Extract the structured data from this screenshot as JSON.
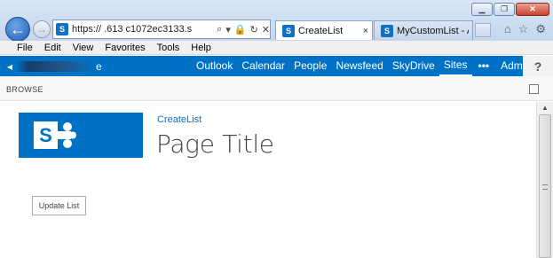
{
  "window": {
    "minimize_glyph": "▁",
    "restore_glyph": "❐",
    "close_glyph": "✕"
  },
  "browser": {
    "back_glyph": "←",
    "forward_glyph": "→",
    "address_url": "https://           .613    c1072ec3133.s",
    "address_tools": [
      "⌕",
      "▾",
      "🔒",
      "↻",
      "✕"
    ],
    "tabs": [
      {
        "label": "CreateList",
        "close": "×"
      },
      {
        "label": "MyCustomList - All...",
        "close": ""
      }
    ],
    "tool_icons": [
      "⌂",
      "☆",
      "⚙"
    ]
  },
  "menubar": {
    "items": [
      "File",
      "Edit",
      "View",
      "Favorites",
      "Tools",
      "Help"
    ]
  },
  "suitebar": {
    "brand_glyph": "◂",
    "brand_suffix": "e",
    "nav": [
      "Outlook",
      "Calendar",
      "People",
      "Newsfeed",
      "SkyDrive",
      "Sites"
    ],
    "current": "Sites",
    "more": "•••",
    "admin": "Admin ▾",
    "help": "?"
  },
  "ribbon": {
    "tab": "BROWSE"
  },
  "page": {
    "breadcrumb": "CreateList",
    "title": "Page Title",
    "update_button": "Update List"
  },
  "colors": {
    "brand": "#0072c6",
    "text": "#444444"
  }
}
